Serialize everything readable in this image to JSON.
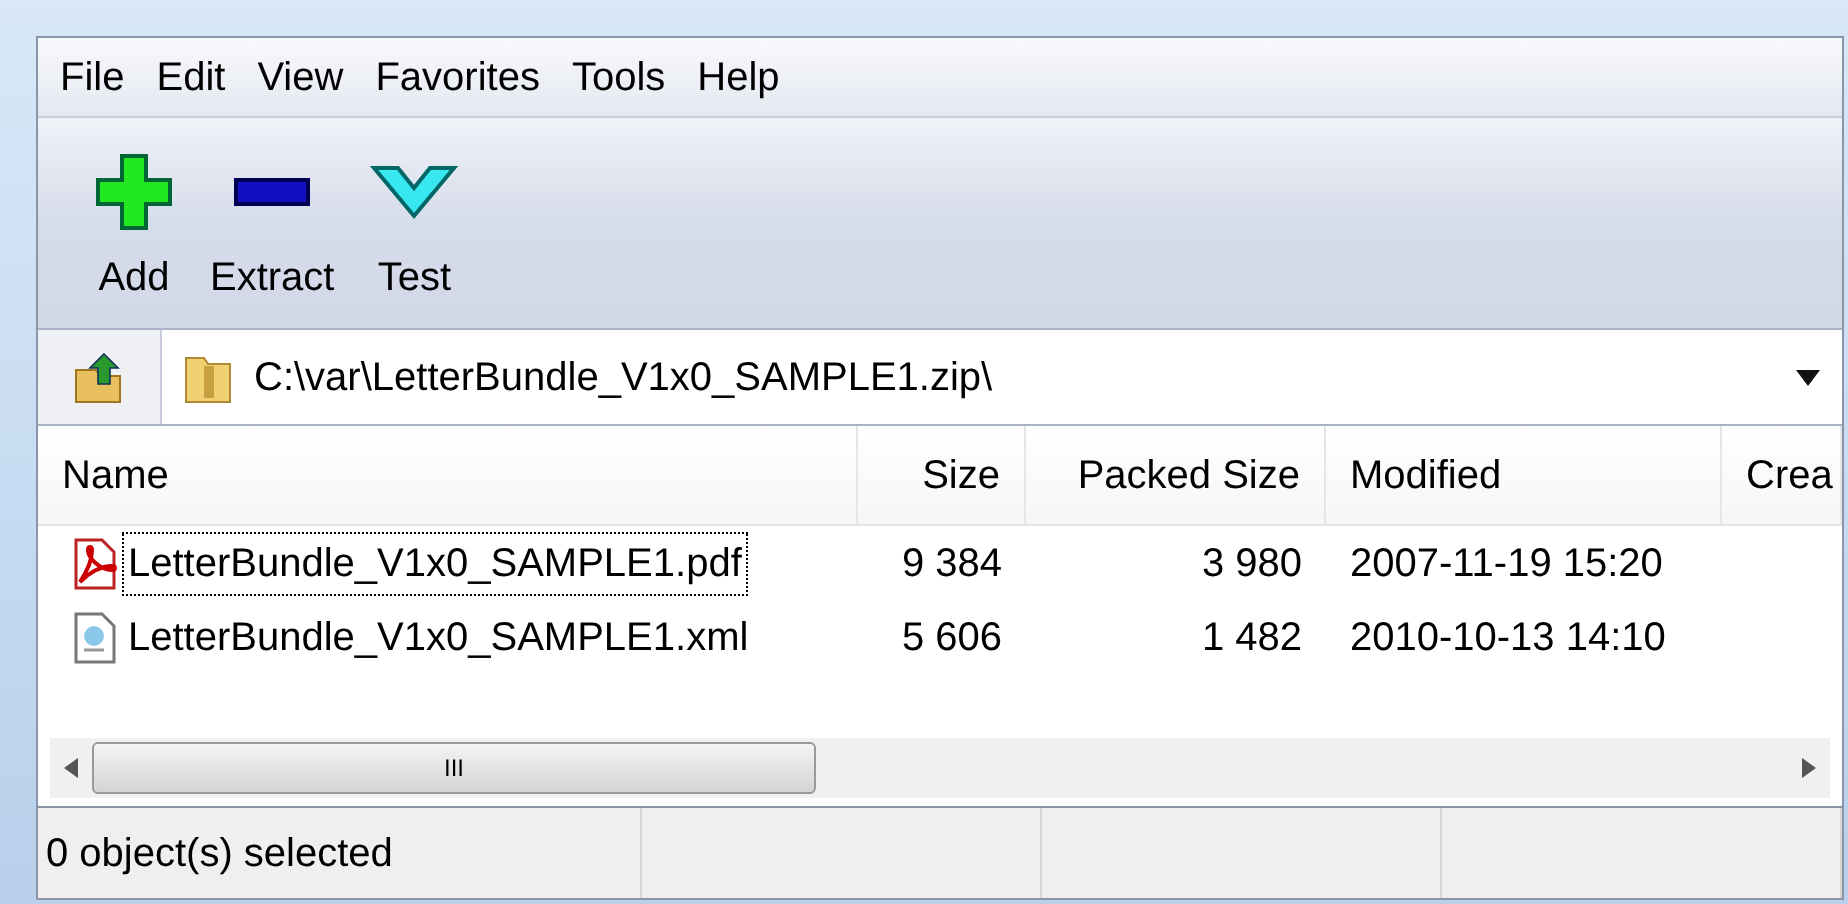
{
  "menu": [
    "File",
    "Edit",
    "View",
    "Favorites",
    "Tools",
    "Help"
  ],
  "toolbar": [
    {
      "label": "Add",
      "kind": "add"
    },
    {
      "label": "Extract",
      "kind": "extract"
    },
    {
      "label": "Test",
      "kind": "test"
    }
  ],
  "address": {
    "value": "C:\\var\\LetterBundle_V1x0_SAMPLE1.zip\\"
  },
  "table": {
    "columns": [
      "Name",
      "Size",
      "Packed Size",
      "Modified",
      "Crea"
    ],
    "rows": [
      {
        "kind": "pdf",
        "focused": true,
        "cells": [
          "LetterBundle_V1x0_SAMPLE1.pdf",
          "9 384",
          "3 980",
          "2007-11-19 15:20"
        ]
      },
      {
        "kind": "xml",
        "focused": false,
        "cells": [
          "LetterBundle_V1x0_SAMPLE1.xml",
          "5 606",
          "1 482",
          "2010-10-13 14:10"
        ]
      }
    ],
    "scroll_glyph": "III"
  },
  "status_bar": [
    "0 object(s) selected"
  ]
}
